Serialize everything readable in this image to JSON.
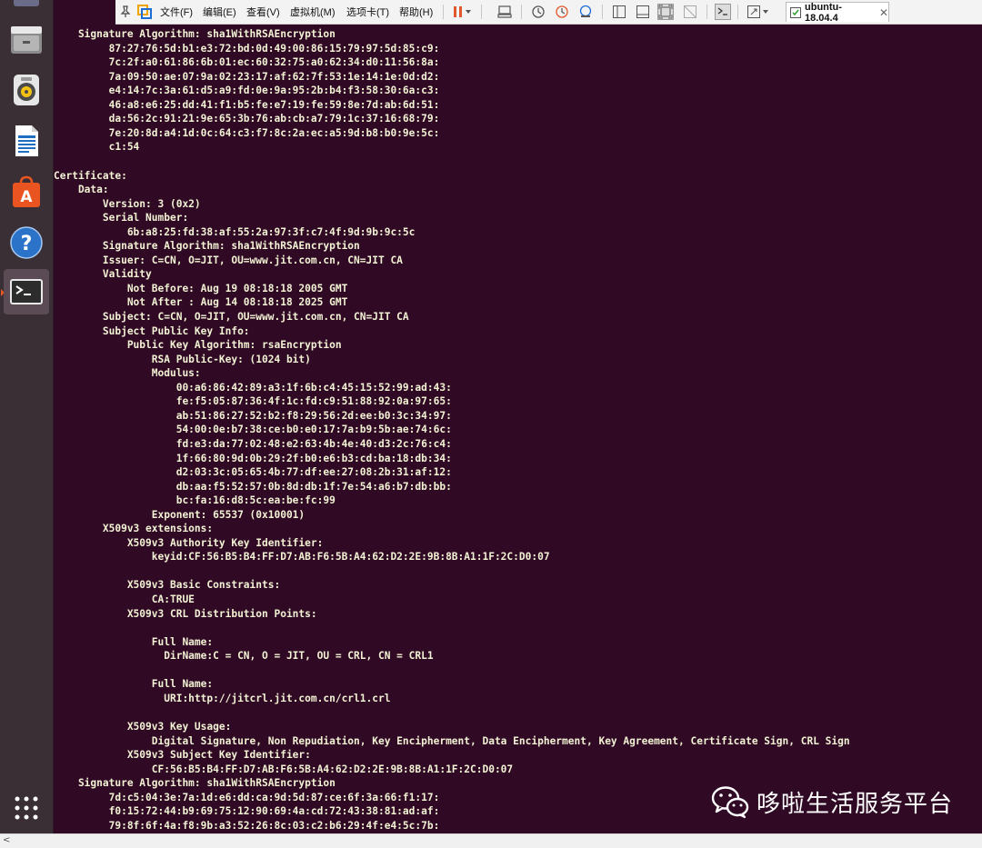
{
  "toolbar": {
    "menu": [
      "文件(F)",
      "编辑(E)",
      "查看(V)",
      "虚拟机(M)",
      "选项卡(T)",
      "帮助(H)"
    ],
    "vm_tab_label": "ubuntu-18.04.4"
  },
  "dock": {
    "items": [
      "files-icon",
      "rhythmbox-icon",
      "writer-icon",
      "software-center-icon",
      "help-icon",
      "terminal-icon"
    ],
    "apps_grid": "show-applications-icon"
  },
  "terminal": {
    "lines": [
      "    Signature Algorithm: sha1WithRSAEncryption",
      "         87:27:76:5d:b1:e3:72:bd:0d:49:00:86:15:79:97:5d:85:c9:",
      "         7c:2f:a0:61:86:6b:01:ec:60:32:75:a0:62:34:d0:11:56:8a:",
      "         7a:09:50:ae:07:9a:02:23:17:af:62:7f:53:1e:14:1e:0d:d2:",
      "         e4:14:7c:3a:61:d5:a9:fd:0e:9a:95:2b:b4:f3:58:30:6a:c3:",
      "         46:a8:e6:25:dd:41:f1:b5:fe:e7:19:fe:59:8e:7d:ab:6d:51:",
      "         da:56:2c:91:21:9e:65:3b:76:ab:cb:a7:79:1c:37:16:68:79:",
      "         7e:20:8d:a4:1d:0c:64:c3:f7:8c:2a:ec:a5:9d:b8:b0:9e:5c:",
      "         c1:54",
      "",
      "Certificate:",
      "    Data:",
      "        Version: 3 (0x2)",
      "        Serial Number:",
      "            6b:a8:25:fd:38:af:55:2a:97:3f:c7:4f:9d:9b:9c:5c",
      "        Signature Algorithm: sha1WithRSAEncryption",
      "        Issuer: C=CN, O=JIT, OU=www.jit.com.cn, CN=JIT CA",
      "        Validity",
      "            Not Before: Aug 19 08:18:18 2005 GMT",
      "            Not After : Aug 14 08:18:18 2025 GMT",
      "        Subject: C=CN, O=JIT, OU=www.jit.com.cn, CN=JIT CA",
      "        Subject Public Key Info:",
      "            Public Key Algorithm: rsaEncryption",
      "                RSA Public-Key: (1024 bit)",
      "                Modulus:",
      "                    00:a6:86:42:89:a3:1f:6b:c4:45:15:52:99:ad:43:",
      "                    fe:f5:05:87:36:4f:1c:fd:c9:51:88:92:0a:97:65:",
      "                    ab:51:86:27:52:b2:f8:29:56:2d:ee:b0:3c:34:97:",
      "                    54:00:0e:b7:38:ce:b0:e0:17:7a:b9:5b:ae:74:6c:",
      "                    fd:e3:da:77:02:48:e2:63:4b:4e:40:d3:2c:76:c4:",
      "                    1f:66:80:9d:0b:29:2f:b0:e6:b3:cd:ba:18:db:34:",
      "                    d2:03:3c:05:65:4b:77:df:ee:27:08:2b:31:af:12:",
      "                    db:aa:f5:52:57:0b:8d:db:1f:7e:54:a6:b7:db:bb:",
      "                    bc:fa:16:d8:5c:ea:be:fc:99",
      "                Exponent: 65537 (0x10001)",
      "        X509v3 extensions:",
      "            X509v3 Authority Key Identifier:",
      "                keyid:CF:56:B5:B4:FF:D7:AB:F6:5B:A4:62:D2:2E:9B:8B:A1:1F:2C:D0:07",
      "",
      "            X509v3 Basic Constraints:",
      "                CA:TRUE",
      "            X509v3 CRL Distribution Points:",
      "",
      "                Full Name:",
      "                  DirName:C = CN, O = JIT, OU = CRL, CN = CRL1",
      "",
      "                Full Name:",
      "                  URI:http://jitcrl.jit.com.cn/crl1.crl",
      "",
      "            X509v3 Key Usage:",
      "                Digital Signature, Non Repudiation, Key Encipherment, Data Encipherment, Key Agreement, Certificate Sign, CRL Sign",
      "            X509v3 Subject Key Identifier:",
      "                CF:56:B5:B4:FF:D7:AB:F6:5B:A4:62:D2:2E:9B:8B:A1:1F:2C:D0:07",
      "    Signature Algorithm: sha1WithRSAEncryption",
      "         7d:c5:04:3e:7a:1d:e6:dd:ca:9d:5d:87:ce:6f:3a:66:f1:17:",
      "         f0:15:72:44:b9:69:75:12:90:69:4a:cd:72:43:38:81:ad:af:",
      "         79:8f:6f:4a:f8:9b:a3:52:26:8c:03:c2:b6:29:4f:e4:5c:7b:"
    ]
  },
  "watermark": {
    "text": "哆啦生活服务平台"
  },
  "scrollbar": {
    "left_arrow": "<"
  }
}
